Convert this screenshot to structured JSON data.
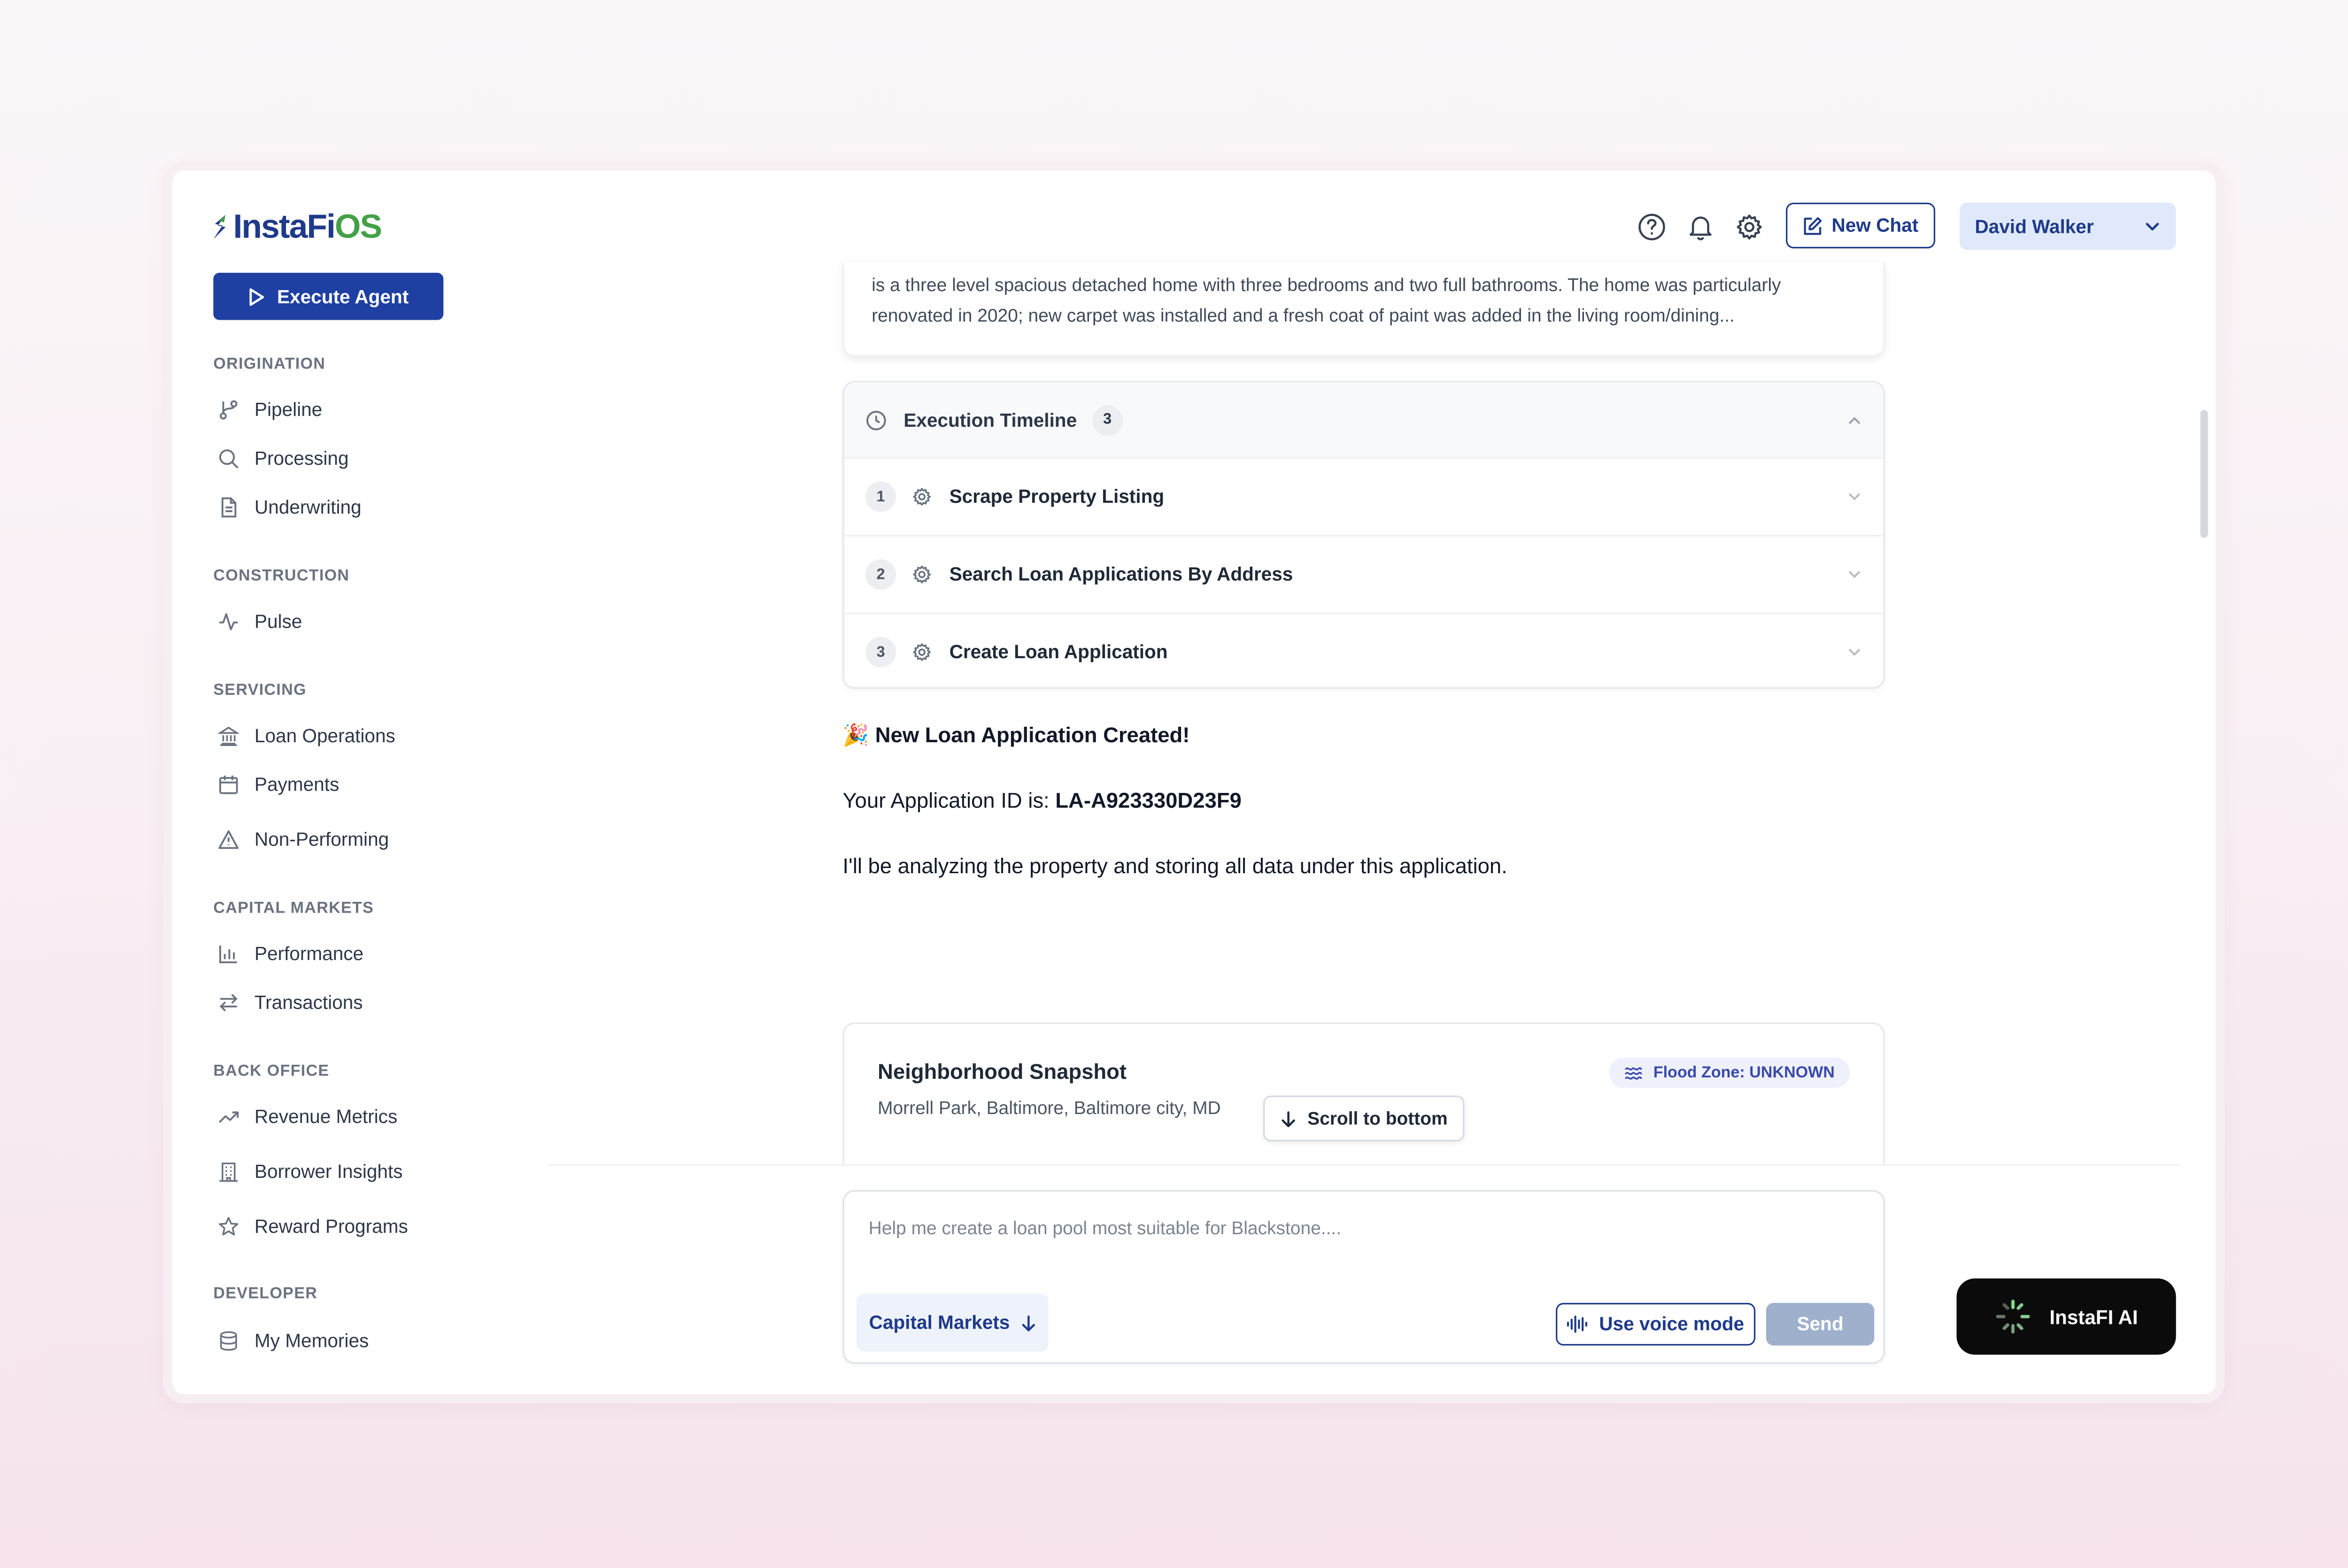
{
  "app": {
    "logo_part1": "InstaFi",
    "logo_part2": "OS"
  },
  "sidebar": {
    "execute_label": "Execute Agent",
    "sections": {
      "origination": "ORIGINATION",
      "construction": "CONSTRUCTION",
      "servicing": "SERVICING",
      "capital_markets": "CAPITAL MARKETS",
      "back_office": "BACK OFFICE",
      "developer": "DEVELOPER"
    },
    "items": {
      "pipeline": "Pipeline",
      "processing": "Processing",
      "underwriting": "Underwriting",
      "pulse": "Pulse",
      "loan_operations": "Loan Operations",
      "payments": "Payments",
      "non_performing": "Non-Performing",
      "performance": "Performance",
      "transactions": "Transactions",
      "revenue_metrics": "Revenue Metrics",
      "borrower_insights": "Borrower Insights",
      "reward_programs": "Reward Programs",
      "my_memories": "My Memories"
    }
  },
  "header": {
    "new_chat_label": "New Chat",
    "user_name": "David Walker"
  },
  "chat": {
    "description_excerpt": "is a three level spacious detached home with three bedrooms and two full bathrooms. The home was particularly renovated in 2020; new carpet was installed and a fresh coat of paint was added in the living room/dining...",
    "timeline": {
      "title": "Execution Timeline",
      "count": "3",
      "steps": [
        {
          "num": "1",
          "label": "Scrape Property Listing"
        },
        {
          "num": "2",
          "label": "Search Loan Applications By Address"
        },
        {
          "num": "3",
          "label": "Create Loan Application"
        }
      ]
    },
    "message": {
      "emoji": "🎉",
      "headline": "New Loan Application Created!",
      "app_id_prefix": "Your Application ID is: ",
      "app_id": "LA-A923330D23F9",
      "body": "I'll be analyzing the property and storing all data under this application."
    },
    "neighborhood": {
      "title": "Neighborhood Snapshot",
      "location": "Morrell Park, Baltimore, Baltimore city, MD",
      "flood_badge": "Flood Zone: UNKNOWN"
    },
    "scroll_to_bottom_label": "Scroll to bottom"
  },
  "composer": {
    "placeholder": "Help me create a loan pool most suitable for Blackstone....",
    "context_label": "Capital Markets",
    "voice_label": "Use voice mode",
    "send_label": "Send"
  },
  "assistant": {
    "label": "InstaFI AI"
  },
  "colors": {
    "brand_navy": "#1e3a8a",
    "brand_green": "#43a047",
    "execute_blue": "#1e40a3",
    "send_disabled": "#9fb0cd"
  },
  "icons": {
    "help": "help-circle-icon",
    "notifications": "bell-icon",
    "settings": "gear-icon",
    "new_chat": "edit-icon",
    "user_menu": "chevron-down-icon"
  }
}
